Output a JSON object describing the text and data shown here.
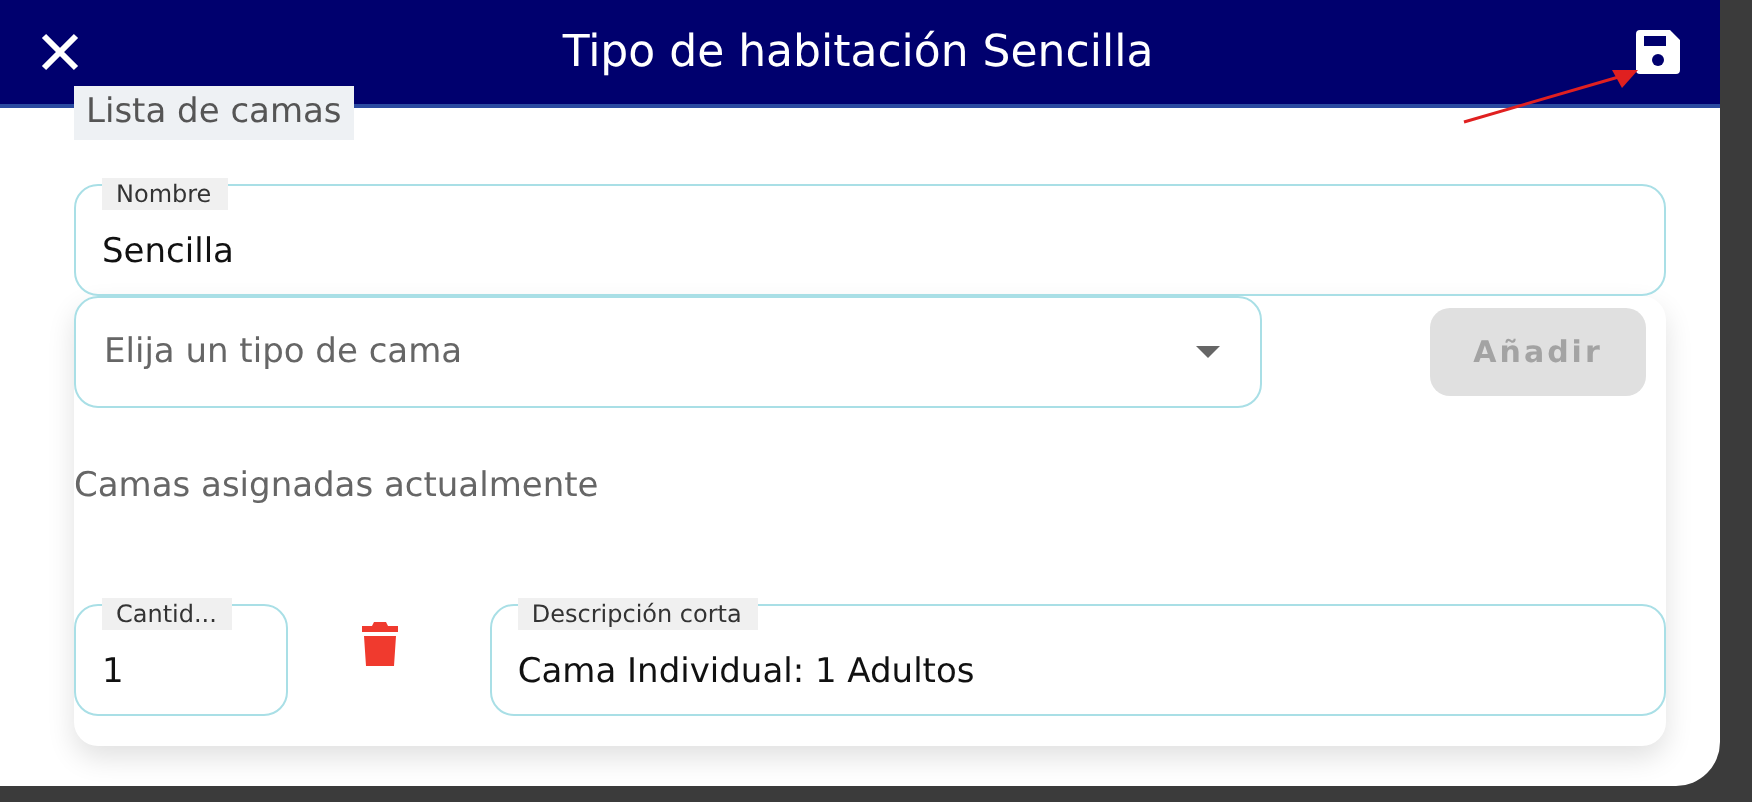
{
  "header": {
    "title": "Tipo de habitación Sencilla"
  },
  "section_label": "Lista de camas",
  "name_field": {
    "label": "Nombre",
    "value": "Sencilla"
  },
  "bed_type_select": {
    "placeholder": "Elija un tipo de cama"
  },
  "add_button": {
    "label": "Añadir",
    "disabled": true
  },
  "assigned_heading": "Camas asignadas actualmente",
  "beds": [
    {
      "quantity_label": "Cantid...",
      "quantity": "1",
      "description_label": "Descripción corta",
      "description": "Cama Individual: 1 Adultos"
    }
  ]
}
